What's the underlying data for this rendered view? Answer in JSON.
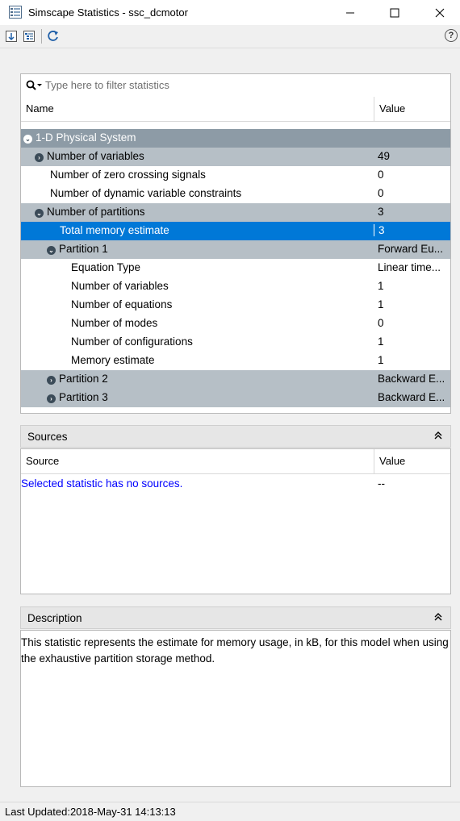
{
  "window": {
    "title": "Simscape Statistics - ssc_dcmotor",
    "minimize": "—",
    "maximize": "☐",
    "close": "✕"
  },
  "toolbar": {
    "expand_all_icon": "expand-all-icon",
    "collapse_icon": "collapse-icon",
    "refresh_icon": "refresh-icon",
    "help_label": "?"
  },
  "statistics": {
    "filter_placeholder": "Type here to filter statistics",
    "columns": {
      "name": "Name",
      "value": "Value"
    },
    "rows": [
      {
        "name": "1-D Physical System",
        "value": ""
      },
      {
        "name": "Number of variables",
        "value": "49"
      },
      {
        "name": "Number of zero crossing signals",
        "value": "0"
      },
      {
        "name": "Number of dynamic variable constraints",
        "value": "0"
      },
      {
        "name": "Number of partitions",
        "value": "3"
      },
      {
        "name": "Total memory estimate",
        "value": "3"
      },
      {
        "name": "Partition 1",
        "value": "Forward Eu..."
      },
      {
        "name": "Equation Type",
        "value": "Linear time..."
      },
      {
        "name": "Number of variables",
        "value": "1"
      },
      {
        "name": "Number of equations",
        "value": "1"
      },
      {
        "name": "Number of modes",
        "value": "0"
      },
      {
        "name": "Number of configurations",
        "value": "1"
      },
      {
        "name": "Memory estimate",
        "value": "1"
      },
      {
        "name": "Partition 2",
        "value": "Backward E..."
      },
      {
        "name": "Partition 3",
        "value": "Backward E..."
      }
    ]
  },
  "sources": {
    "title": "Sources",
    "collapse": "»",
    "columns": {
      "source": "Source",
      "value": "Value"
    },
    "message": "Selected statistic has no sources.",
    "message_value": "--"
  },
  "description": {
    "title": "Description",
    "collapse": "»",
    "text": "This statistic represents the estimate for memory usage, in kB, for this model when using the exhaustive partition storage method."
  },
  "status": {
    "last_updated": "Last Updated:2018-May-31 14:13:13"
  },
  "colors": {
    "selection": "#0078d7",
    "group_row": "#b6bfc6",
    "top_row": "#8d9ba6",
    "link_text": "#0000ff"
  }
}
